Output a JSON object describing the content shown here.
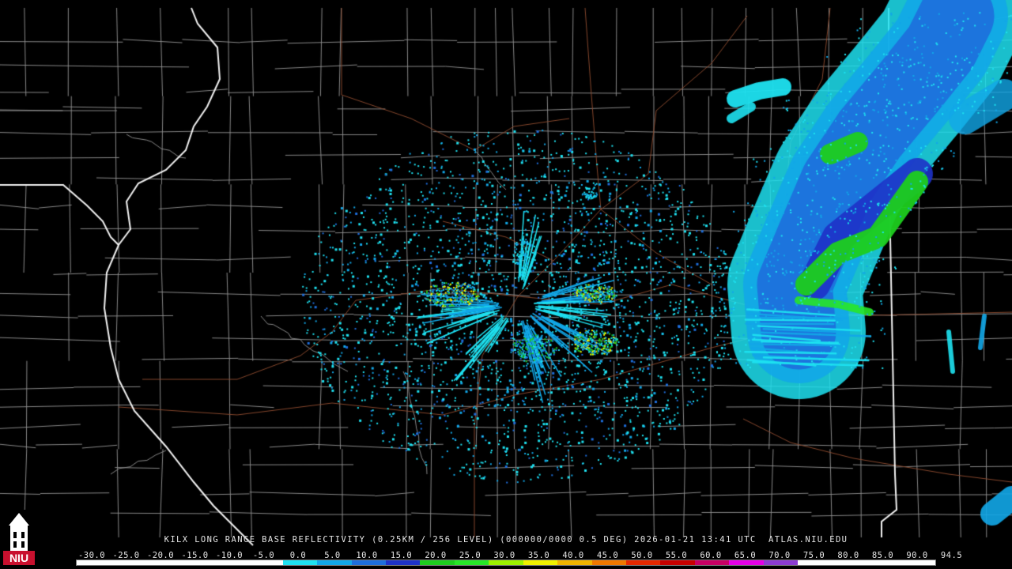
{
  "product_caption": "KILX LONG RANGE BASE REFLECTIVITY (0.25KM / 256 LEVEL) (000000/0000 0.5 DEG) 2026-01-21 13:41 UTC  ATLAS.NIU.EDU",
  "logo": {
    "name": "NIU logo",
    "text": "NIU",
    "colors": {
      "red": "#c8102e",
      "white": "#ffffff",
      "black": "#000000"
    }
  },
  "color_scale": {
    "ticks": [
      "-30.0",
      "-25.0",
      "-20.0",
      "-15.0",
      "-10.0",
      "-5.0",
      "0.0",
      "5.0",
      "10.0",
      "15.0",
      "20.0",
      "25.0",
      "30.0",
      "35.0",
      "40.0",
      "45.0",
      "50.0",
      "55.0",
      "60.0",
      "65.0",
      "70.0",
      "75.0",
      "80.0",
      "85.0",
      "90.0",
      "94.5"
    ],
    "colors": [
      "#ffffff",
      "#ffffff",
      "#ffffff",
      "#ffffff",
      "#ffffff",
      "#ffffff",
      "#1ee1f0",
      "#12a7e8",
      "#1e6edc",
      "#1e32c8",
      "#1ecd1e",
      "#28e628",
      "#9cf000",
      "#f0f000",
      "#f0b400",
      "#f07800",
      "#e62800",
      "#c80000",
      "#c80064",
      "#e600e6",
      "#8c3cd2",
      "#ffffff",
      "#ffffff",
      "#ffffff",
      "#ffffff"
    ]
  },
  "map_colors": {
    "background": "#000000",
    "county_lines": "#8e8e8e",
    "state_lines": "#ffffff",
    "highways": "#8b4a2e",
    "radar_light": "#1ee1f0",
    "radar_mid": "#12a7e8",
    "radar_blue": "#1e6edc",
    "radar_dark": "#1e32c8",
    "radar_green": "#1ecd1e",
    "radar_lime": "#28e628",
    "radar_yellow": "#f0f000"
  }
}
